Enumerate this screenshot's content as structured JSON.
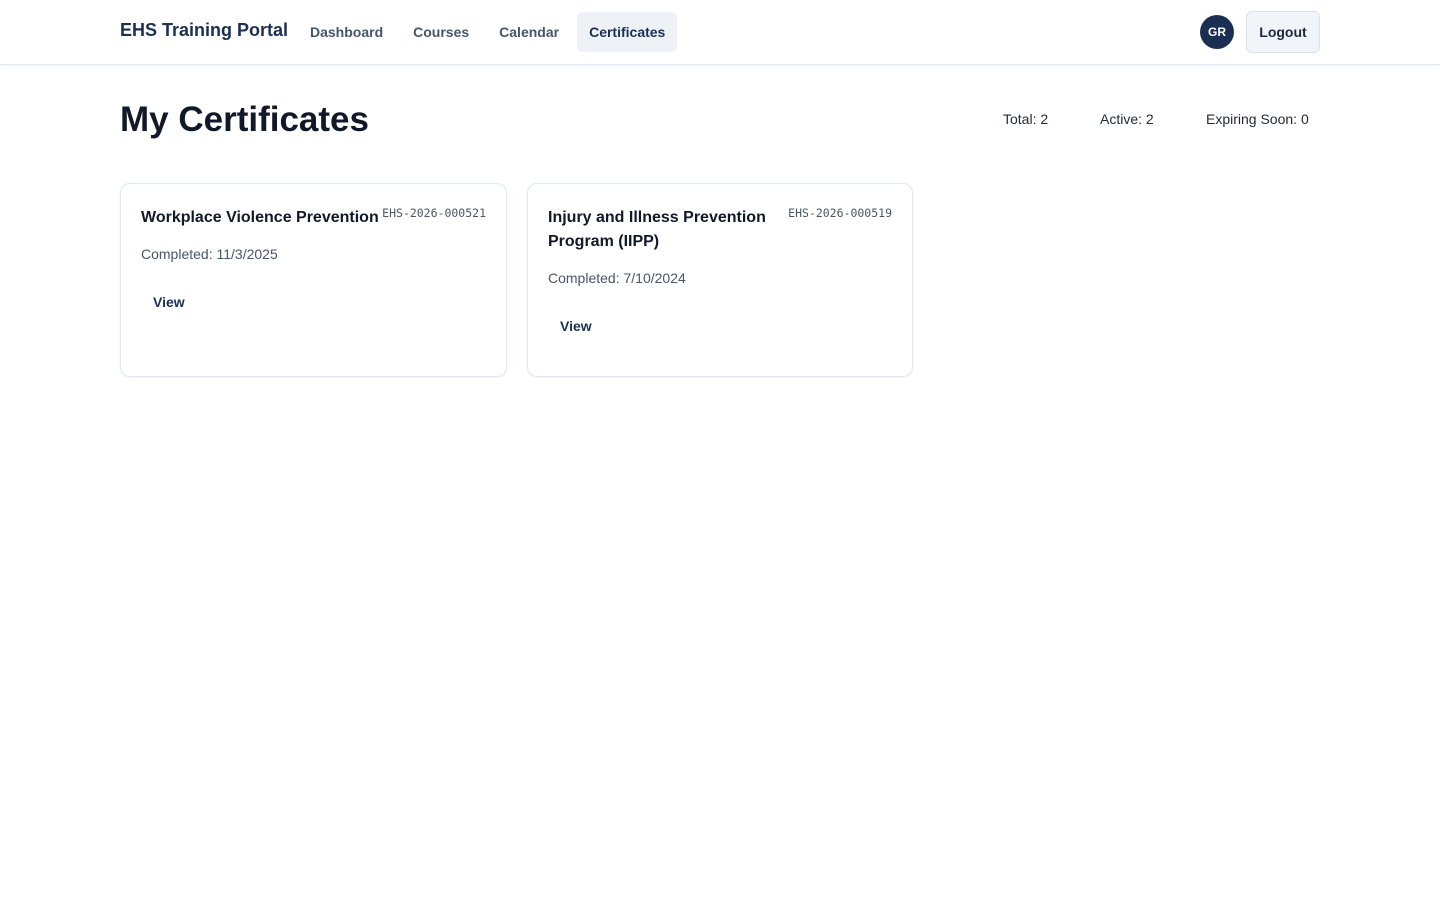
{
  "header": {
    "brand": "EHS Training Portal",
    "nav": [
      {
        "label": "Dashboard",
        "active": false
      },
      {
        "label": "Courses",
        "active": false
      },
      {
        "label": "Calendar",
        "active": false
      },
      {
        "label": "Certificates",
        "active": true
      }
    ],
    "user_initials": "GR",
    "logout_label": "Logout"
  },
  "main": {
    "title": "My Certificates",
    "stats": {
      "total": "Total: 2",
      "active": "Active: 2",
      "expiring": "Expiring Soon: 0"
    },
    "certificates": [
      {
        "title": "Workplace Violence Prevention",
        "id": "EHS-2026-000521",
        "completed": "Completed: 11/3/2025",
        "action_label": "View"
      },
      {
        "title": "Injury and Illness Prevention Program (IIPP)",
        "id": "EHS-2026-000519",
        "completed": "Completed: 7/10/2024",
        "action_label": "View"
      }
    ]
  },
  "colors": {
    "brand_navy": "#1a2f52",
    "active_nav_bg": "#eef2f7",
    "border": "#e2e8f0"
  }
}
